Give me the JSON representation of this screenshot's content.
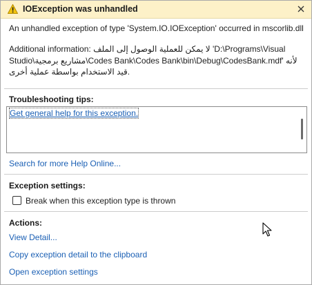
{
  "titlebar": {
    "title": "IOException was unhandled",
    "icon": "warning-icon",
    "close_icon": "close-icon",
    "background": "#fdf1c8"
  },
  "message": {
    "main": "An unhandled exception of type 'System.IO.IOException' occurred in mscorlib.dll",
    "additional_lines": [
      "Additional information: لا يمكن للعملية الوصول إلى الملف 'D:\\Programs\\Visual",
      "Studio\\مشاريع برمجية\\Codes Bank\\Codes Bank\\bin\\Debug\\CodesBank.mdf' لأنه",
      "قيد الاستخدام بواسطة عملية أخرى."
    ]
  },
  "troubleshooting": {
    "title": "Troubleshooting tips:",
    "tips": [
      "Get general help for this exception."
    ],
    "search_link": "Search for more Help Online..."
  },
  "exception_settings": {
    "title": "Exception settings:",
    "break_label": "Break when this exception type is thrown",
    "break_checked": false
  },
  "actions": {
    "title": "Actions:",
    "items": [
      "View Detail...",
      "Copy exception detail to the clipboard",
      "Open exception settings"
    ]
  },
  "colors": {
    "link": "#1a5fb4",
    "separator": "#cccccc",
    "warning": "#f2c40f"
  }
}
